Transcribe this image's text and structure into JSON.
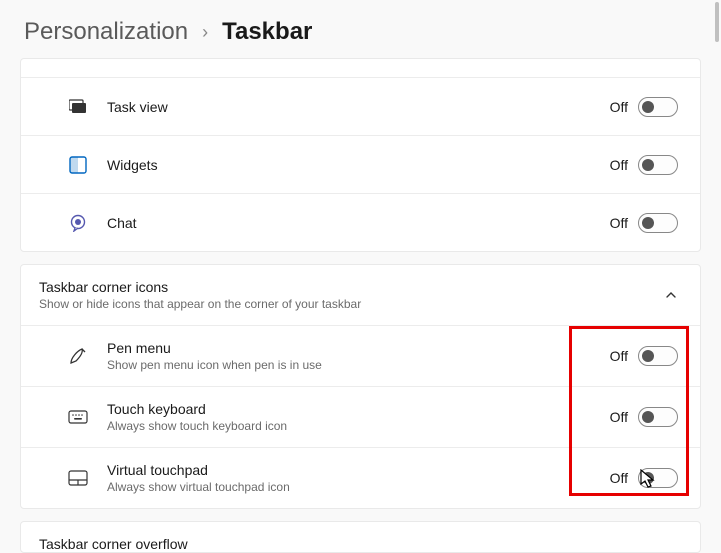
{
  "breadcrumb": {
    "parent": "Personalization",
    "sep": "›",
    "current": "Taskbar"
  },
  "items": {
    "taskview": {
      "title": "Task view",
      "state": "Off"
    },
    "widgets": {
      "title": "Widgets",
      "state": "Off"
    },
    "chat": {
      "title": "Chat",
      "state": "Off"
    }
  },
  "cornerSection": {
    "title": "Taskbar corner icons",
    "subtitle": "Show or hide icons that appear on the corner of your taskbar"
  },
  "corner": {
    "pen": {
      "title": "Pen menu",
      "subtitle": "Show pen menu icon when pen is in use",
      "state": "Off"
    },
    "keyboard": {
      "title": "Touch keyboard",
      "subtitle": "Always show touch keyboard icon",
      "state": "Off"
    },
    "touchpad": {
      "title": "Virtual touchpad",
      "subtitle": "Always show virtual touchpad icon",
      "state": "Off"
    }
  },
  "overflowSection": {
    "title": "Taskbar corner overflow"
  }
}
